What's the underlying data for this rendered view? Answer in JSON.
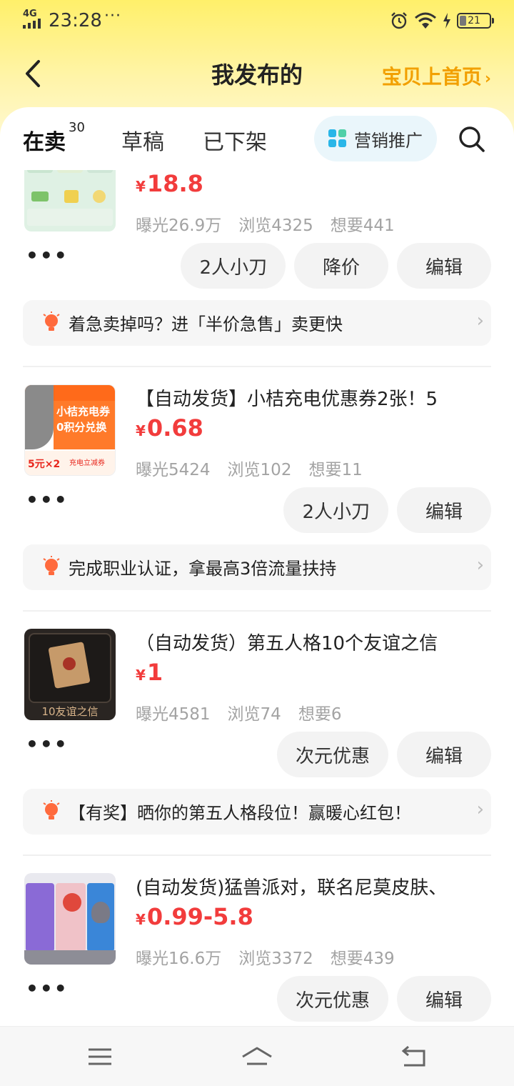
{
  "status_bar": {
    "network": "4G",
    "time": "23:28",
    "dots": "···",
    "battery": "21"
  },
  "nav": {
    "title": "我发布的",
    "home_link": "宝贝上首页",
    "home_arrow": "›"
  },
  "tabs": {
    "on_sale": "在卖",
    "on_sale_count": "30",
    "draft": "草稿",
    "off_shelf": "已下架",
    "promo": "营销推广"
  },
  "items": [
    {
      "title": "",
      "yen": "¥",
      "price": "18.8",
      "stats": [
        "曝光26.9万",
        "浏览4325",
        "想要441"
      ],
      "actions": [
        "2人小刀",
        "降价",
        "编辑"
      ],
      "tip": "着急卖掉吗？进「半价急售」卖更快"
    },
    {
      "title": "【自动发货】小桔充电优惠券2张！5",
      "yen": "¥",
      "price": "0.68",
      "stats": [
        "曝光5424",
        "浏览102",
        "想要11"
      ],
      "actions": [
        "2人小刀",
        "编辑"
      ],
      "tip": "完成职业认证，拿最高3倍流量扶持",
      "thumb_texts": [
        "小桔充电券",
        "0积分兑换",
        "5元×2",
        "充电立减券"
      ]
    },
    {
      "title": "（自动发货）第五人格10个友谊之信",
      "yen": "¥",
      "price": "1",
      "stats": [
        "曝光4581",
        "浏览74",
        "想要6"
      ],
      "actions": [
        "次元优惠",
        "编辑"
      ],
      "tip": "【有奖】晒你的第五人格段位！赢暖心红包！",
      "thumb_caption": "10友谊之信"
    },
    {
      "title": "(自动发货)猛兽派对，联名尼莫皮肤、",
      "yen": "¥",
      "price": "0.99-5.8",
      "stats": [
        "曝光16.6万",
        "浏览3372",
        "想要439"
      ],
      "actions": [
        "次元优惠",
        "编辑"
      ]
    }
  ],
  "colors": {
    "accent_yellow": "#ffe500",
    "price_red": "#f23c3c",
    "home_link": "#f2a000"
  },
  "icons": [
    "back-arrow-icon",
    "grid-icon",
    "search-icon",
    "bulb-icon",
    "chevron-right-icon",
    "menu-icon",
    "home-icon",
    "back-icon"
  ]
}
